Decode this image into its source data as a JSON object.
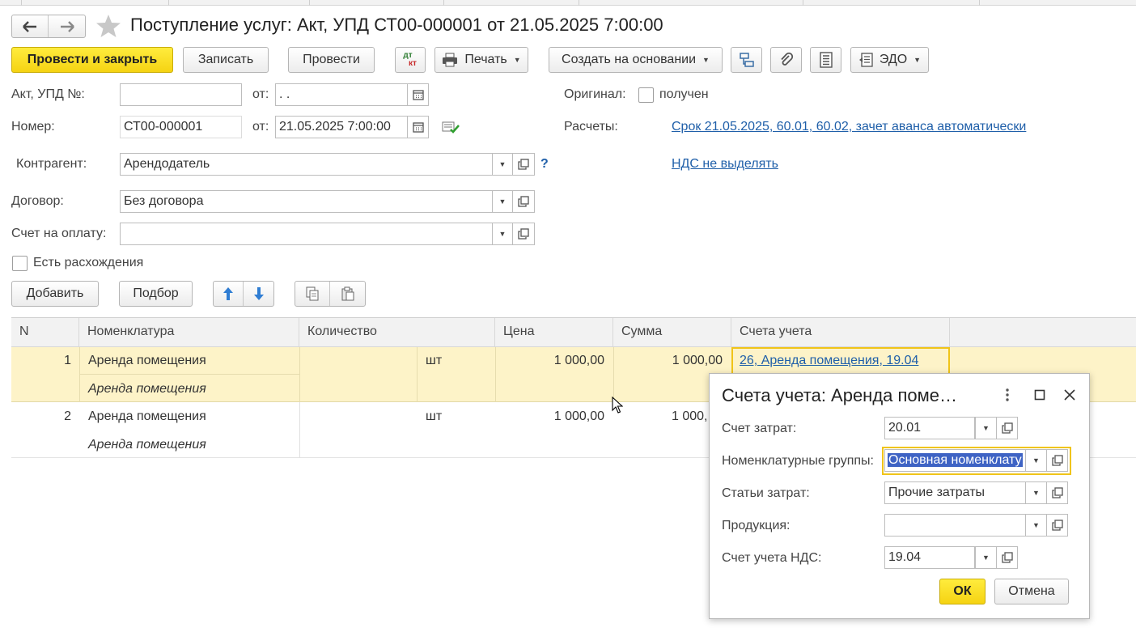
{
  "window": {
    "title": "Поступление услуг: Акт, УПД СТ00-000001 от 21.05.2025 7:00:00"
  },
  "toolbar": {
    "post_close": "Провести и закрыть",
    "save": "Записать",
    "post": "Провести",
    "dtkt_top": "дт",
    "dtkt_bottom": "кт",
    "print": "Печать",
    "create_based": "Создать на основании",
    "edo": "ЭДО"
  },
  "form": {
    "act_label": "Акт, УПД №:",
    "act_value": "",
    "from_label": "от:",
    "act_date": " .  .",
    "number_label": "Номер:",
    "number_value": "СТ00-000001",
    "number_date": "21.05.2025  7:00:00",
    "original_label": "Оригинал:",
    "original_received": "получен",
    "settlements_label": "Расчеты:",
    "settlements_link": "Срок 21.05.2025, 60.01, 60.02, зачет аванса автоматически",
    "vat_link": "НДС не выделять",
    "counterparty_label": "Контрагент:",
    "counterparty_value": "Арендодатель",
    "help": "?",
    "contract_label": "Договор:",
    "contract_value": "Без договора",
    "invoice_label": "Счет на оплату:",
    "invoice_value": "",
    "discrepancy_label": "Есть расхождения"
  },
  "table_toolbar": {
    "add": "Добавить",
    "pick": "Подбор"
  },
  "table": {
    "columns": [
      "N",
      "Номенклатура",
      "Количество",
      "Цена",
      "Сумма",
      "Счета учета"
    ],
    "rows": [
      {
        "n": "1",
        "item": "Аренда помещения",
        "item_sub": "Аренда помещения",
        "unit": "шт",
        "price": "1 000,00",
        "sum": "1 000,00",
        "accounts": "26, Аренда помещения, 19.04"
      },
      {
        "n": "2",
        "item": "Аренда помещения",
        "item_sub": "Аренда помещения",
        "unit": "шт",
        "price": "1 000,00",
        "sum": "1 000,"
      }
    ]
  },
  "dialog": {
    "title": "Счета учета: Аренда поме…",
    "cost_account_label": "Счет затрат:",
    "cost_account_value": "20.01",
    "nomenclature_groups_label": "Номенклатурные группы:",
    "nomenclature_groups_value": "Основная номенклату",
    "cost_items_label": "Статьи затрат:",
    "cost_items_value": "Прочие затраты",
    "products_label": "Продукция:",
    "products_value": "",
    "vat_account_label": "Счет учета НДС:",
    "vat_account_value": "19.04",
    "ok": "ОК",
    "cancel": "Отмена"
  },
  "colors": {
    "accent_yellow": "#f5d313",
    "row_selected": "#fdf3c8",
    "link": "#1f5fa9",
    "selection": "#3e63c4"
  }
}
